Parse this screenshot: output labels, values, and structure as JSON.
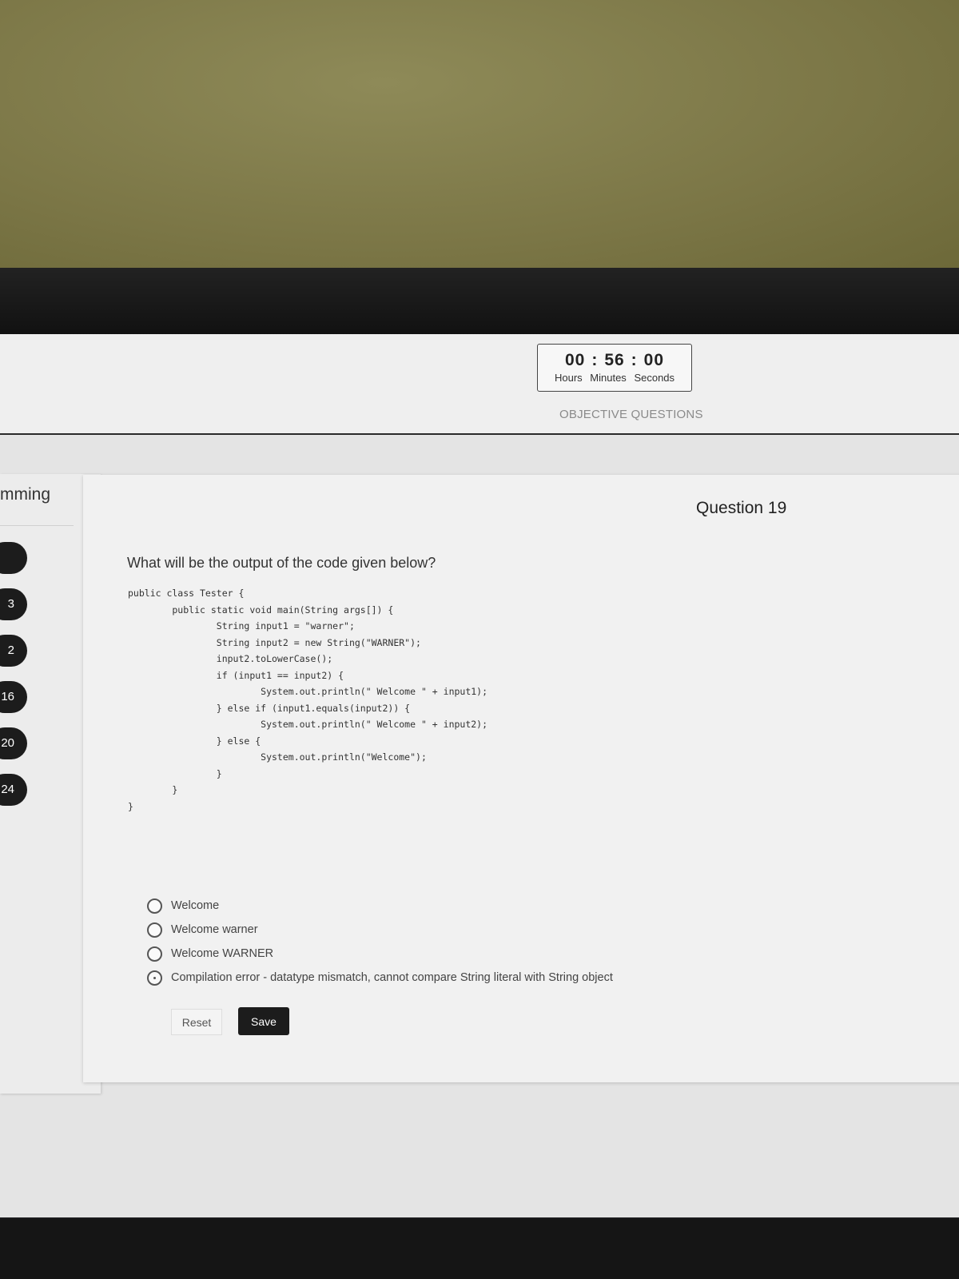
{
  "timer": {
    "hours": "00",
    "minutes": "56",
    "seconds": "00",
    "separator": ":",
    "hours_label": "Hours",
    "minutes_label": "Minutes",
    "seconds_label": "Seconds"
  },
  "header": {
    "section_label": "OBJECTIVE QUESTIONS"
  },
  "sidebar": {
    "title": "mming",
    "items": [
      {
        "label": ""
      },
      {
        "label": "3"
      },
      {
        "label": "2"
      },
      {
        "label": "16"
      },
      {
        "label": "20"
      },
      {
        "label": "24"
      }
    ]
  },
  "question": {
    "number": "Question 19",
    "text": "What will be the output of the code given below?",
    "code": "public class Tester {\n        public static void main(String args[]) {\n                String input1 = \"warner\";\n                String input2 = new String(\"WARNER\");\n                input2.toLowerCase();\n                if (input1 == input2) {\n                        System.out.println(\" Welcome \" + input1);\n                } else if (input1.equals(input2)) {\n                        System.out.println(\" Welcome \" + input2);\n                } else {\n                        System.out.println(\"Welcome\");\n                }\n        }\n}",
    "options": [
      "Welcome",
      "Welcome warner",
      "Welcome WARNER",
      "Compilation error - datatype mismatch, cannot compare String literal with String object"
    ]
  },
  "actions": {
    "reset_label": "Reset",
    "save_label": "Save"
  }
}
